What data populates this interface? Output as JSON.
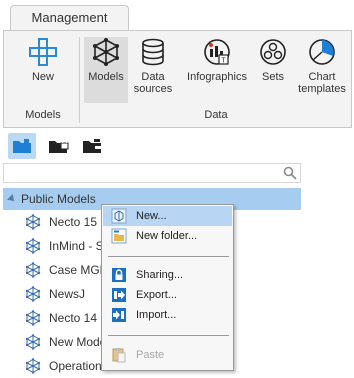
{
  "ribbon": {
    "active_tab": "Management",
    "buttons": {
      "new": "New",
      "models": "Models",
      "data_sources": [
        "Data",
        "sources"
      ],
      "infographics": "Infographics",
      "sets": "Sets",
      "chart_templates": [
        "Chart",
        "templates"
      ]
    },
    "groups": {
      "models": "Models",
      "data": "Data"
    }
  },
  "tree": {
    "root": "Public Models",
    "items": [
      "Necto 15 D",
      "InMind - Sa",
      "Case MGM",
      "NewsJ",
      "Necto 14 D",
      "New Mode",
      "Operations"
    ]
  },
  "context_menu": {
    "new": "New...",
    "new_folder": "New folder...",
    "sharing": "Sharing...",
    "export": "Export...",
    "import": "Import...",
    "paste": "Paste"
  },
  "colors": {
    "accent": "#1e7fd4",
    "selection": "#a6cdf0",
    "menu_highlight": "#b8d6f4",
    "ribbon_bg": "#f3f3f3"
  }
}
